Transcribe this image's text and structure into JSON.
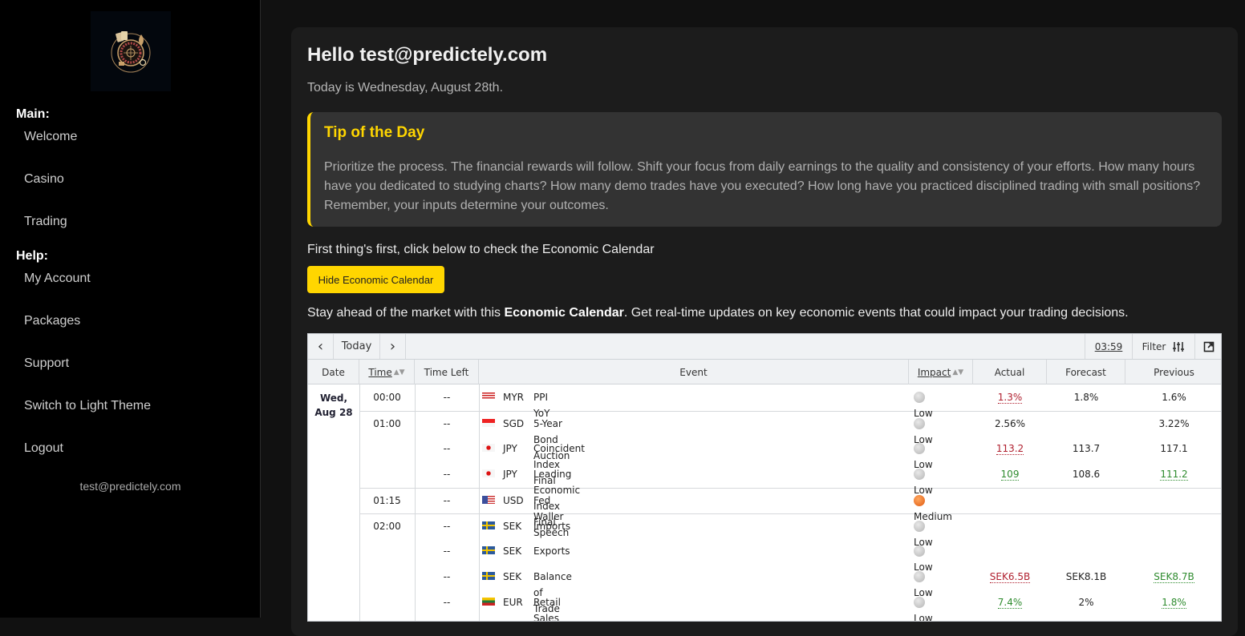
{
  "sidebar": {
    "logo_alt": "casino-roulette-logo",
    "sections": [
      {
        "title": "Main:",
        "items": [
          "Welcome",
          "Casino",
          "Trading"
        ]
      },
      {
        "title": "Help:",
        "items": [
          "My Account",
          "Packages",
          "Support",
          "Switch to Light Theme",
          "Logout"
        ]
      }
    ],
    "user_email": "test@predictely.com"
  },
  "main": {
    "greeting": "Hello test@predictely.com",
    "today": "Today is Wednesday, August 28th.",
    "tip": {
      "title": "Tip of the Day",
      "text": "Prioritize the process. The financial rewards will follow. Shift your focus from daily earnings to the quality and consistency of your efforts. How many hours have you dedicated to studying charts? How many demo trades have you executed? How long have you practiced disciplined trading with small positions? Remember, your inputs determine your outcomes."
    },
    "first_text": "First thing's first, click below to check the Economic Calendar",
    "hide_button": "Hide Economic Calendar",
    "stay_pre": "Stay ahead of the market with this ",
    "stay_bold": "Economic Calendar",
    "stay_post": ". Get real-time updates on key economic events that could impact your trading decisions."
  },
  "calendar": {
    "toolbar": {
      "prev": "‹",
      "today": "Today",
      "next": "›",
      "clock": "03:59",
      "filter": "Filter",
      "filter_icon": "sliders-icon",
      "popout_icon": "external-link-icon"
    },
    "headers": {
      "date": "Date",
      "time": "Time",
      "time_left": "Time Left",
      "event": "Event",
      "impact": "Impact",
      "actual": "Actual",
      "forecast": "Forecast",
      "previous": "Previous"
    },
    "date_label_1": "Wed,",
    "date_label_2": "Aug 28",
    "rows": [
      {
        "time": "00:00",
        "left": "--",
        "flag": "MY",
        "cur": "MYR",
        "event": "PPI YoY",
        "impact": "Low",
        "actual": "1.3%",
        "actual_dir": "down",
        "forecast": "1.8%",
        "previous": "1.6%",
        "previous_dir": ""
      },
      {
        "time": "01:00",
        "left": "--",
        "flag": "SG",
        "cur": "SGD",
        "event": "5-Year Bond Auction",
        "impact": "Low",
        "actual": "2.56%",
        "actual_dir": "",
        "forecast": "",
        "previous": "3.22%",
        "previous_dir": ""
      },
      {
        "time": "",
        "left": "--",
        "flag": "JP",
        "cur": "JPY",
        "event": "Coincident Index Final",
        "impact": "Low",
        "actual": "113.2",
        "actual_dir": "down",
        "forecast": "113.7",
        "previous": "117.1",
        "previous_dir": ""
      },
      {
        "time": "",
        "left": "--",
        "flag": "JP",
        "cur": "JPY",
        "event": "Leading Economic Index Final",
        "impact": "Low",
        "actual": "109",
        "actual_dir": "up",
        "forecast": "108.6",
        "previous": "111.2",
        "previous_dir": "up"
      },
      {
        "time": "01:15",
        "left": "--",
        "flag": "US",
        "cur": "USD",
        "event": "Fed Waller Speech",
        "impact": "Medium",
        "actual": "",
        "actual_dir": "",
        "forecast": "",
        "previous": "",
        "previous_dir": ""
      },
      {
        "time": "02:00",
        "left": "--",
        "flag": "SE",
        "cur": "SEK",
        "event": "Imports",
        "impact": "Low",
        "actual": "",
        "actual_dir": "",
        "forecast": "",
        "previous": "",
        "previous_dir": ""
      },
      {
        "time": "",
        "left": "--",
        "flag": "SE",
        "cur": "SEK",
        "event": "Exports",
        "impact": "Low",
        "actual": "",
        "actual_dir": "",
        "forecast": "",
        "previous": "",
        "previous_dir": ""
      },
      {
        "time": "",
        "left": "--",
        "flag": "SE",
        "cur": "SEK",
        "event": "Balance of Trade",
        "impact": "Low",
        "actual": "SEK6.5B",
        "actual_dir": "down",
        "forecast": "SEK8.1B",
        "previous": "SEK8.7B",
        "previous_dir": "up"
      },
      {
        "time": "",
        "left": "--",
        "flag": "LT",
        "cur": "EUR",
        "event": "Retail Sales YoY",
        "impact": "Low",
        "actual": "7.4%",
        "actual_dir": "up",
        "forecast": "2%",
        "previous": "1.8%",
        "previous_dir": "up"
      }
    ]
  },
  "colors": {
    "accent": "#ffd600",
    "down": "#b0202f",
    "up": "#2e8b2e"
  }
}
